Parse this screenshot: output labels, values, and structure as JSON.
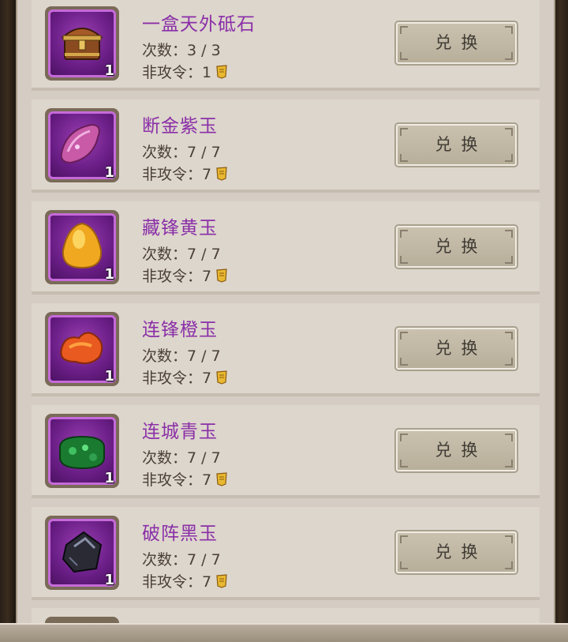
{
  "exchange_list": {
    "button_label": "兑换",
    "count_prefix": "次数：",
    "cost_prefix": "非攻令：",
    "items": [
      {
        "name": "一盒天外砥石",
        "icon": "treasure-chest-icon",
        "quantity": "1",
        "count": "3 / 3",
        "cost": "1"
      },
      {
        "name": "断金紫玉",
        "icon": "purple-jade-icon",
        "quantity": "1",
        "count": "7 / 7",
        "cost": "7"
      },
      {
        "name": "藏锋黄玉",
        "icon": "yellow-jade-icon",
        "quantity": "1",
        "count": "7 / 7",
        "cost": "7"
      },
      {
        "name": "连锋橙玉",
        "icon": "orange-jade-icon",
        "quantity": "1",
        "count": "7 / 7",
        "cost": "7"
      },
      {
        "name": "连城青玉",
        "icon": "green-jade-icon",
        "quantity": "1",
        "count": "7 / 7",
        "cost": "7"
      },
      {
        "name": "破阵黑玉",
        "icon": "black-jade-icon",
        "quantity": "1",
        "count": "7 / 7",
        "cost": "7"
      }
    ]
  },
  "colors": {
    "item_name": "#8a2fa8",
    "icon_frame_purple": "#6a1e86",
    "button_bg": "#c1b8a5",
    "panel_bg": "#d5cdc4"
  }
}
